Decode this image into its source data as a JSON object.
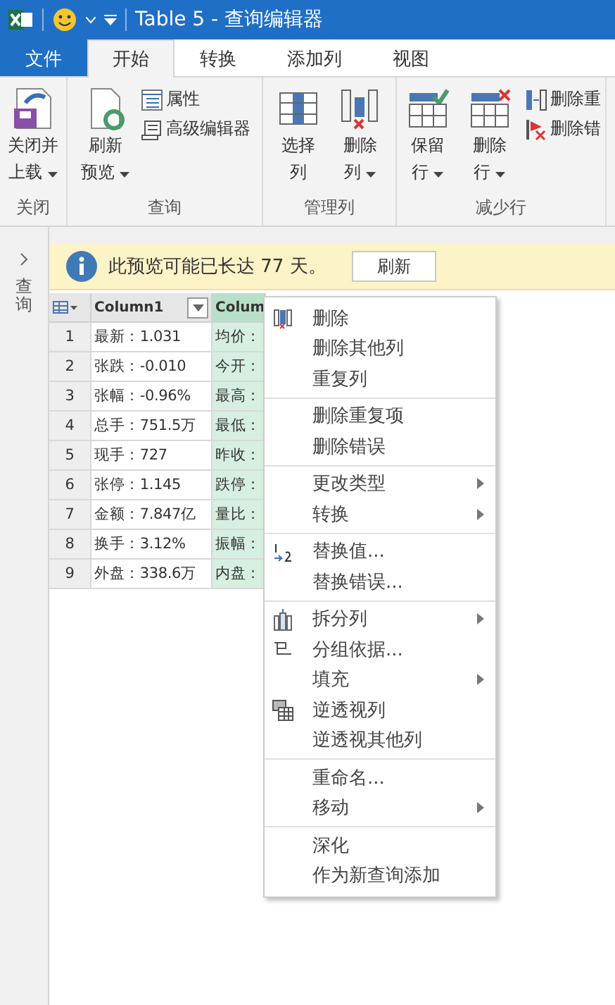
{
  "window": {
    "title": "Table 5 - 查询编辑器"
  },
  "tabs": [
    {
      "label": "文件",
      "kind": "file",
      "selected": false
    },
    {
      "label": "开始",
      "kind": "tab",
      "selected": true
    },
    {
      "label": "转换",
      "kind": "tab",
      "selected": false
    },
    {
      "label": "添加列",
      "kind": "tab",
      "selected": false
    },
    {
      "label": "视图",
      "kind": "tab",
      "selected": false
    }
  ],
  "ribbon": [
    {
      "label": "关闭",
      "items": [
        {
          "kind": "large",
          "lines": [
            "关闭并",
            "上载"
          ],
          "dropdown": true
        }
      ]
    },
    {
      "label": "查询",
      "items": [
        {
          "kind": "large",
          "lines": [
            "刷新",
            "预览"
          ],
          "dropdown": true
        },
        {
          "kind": "stack",
          "entries": [
            "属性",
            "高级编辑器"
          ]
        }
      ]
    },
    {
      "label": "管理列",
      "items": [
        {
          "kind": "large",
          "lines": [
            "选择",
            "列"
          ],
          "dropdown": false
        },
        {
          "kind": "large",
          "lines": [
            "删除",
            "列"
          ],
          "dropdown": true
        }
      ]
    },
    {
      "label": "减少行",
      "items": [
        {
          "kind": "large",
          "lines": [
            "保留",
            "行"
          ],
          "dropdown": true
        },
        {
          "kind": "large",
          "lines": [
            "删除",
            "行"
          ],
          "dropdown": true
        },
        {
          "kind": "stack",
          "entries": [
            "删除重",
            "删除错"
          ]
        }
      ]
    }
  ],
  "side_pane": {
    "label": "查询",
    "expanded": false
  },
  "notice": {
    "message": "此预览可能已长达 77 天。",
    "button": "刷新"
  },
  "table": {
    "columns": [
      {
        "name": "Column1",
        "selected": false
      },
      {
        "name": "Colum",
        "selected": true
      }
    ],
    "rows": [
      {
        "number": "1",
        "cells": [
          "最新：1.031",
          "均价："
        ]
      },
      {
        "number": "2",
        "cells": [
          "张跌：-0.010",
          "今开："
        ]
      },
      {
        "number": "3",
        "cells": [
          "张幅：-0.96%",
          "最高："
        ]
      },
      {
        "number": "4",
        "cells": [
          "总手：751.5万",
          "最低："
        ]
      },
      {
        "number": "5",
        "cells": [
          "现手：727",
          "昨收："
        ]
      },
      {
        "number": "6",
        "cells": [
          "张停：1.145",
          "跌停："
        ]
      },
      {
        "number": "7",
        "cells": [
          "金额：7.847亿",
          "量比："
        ]
      },
      {
        "number": "8",
        "cells": [
          "换手：3.12%",
          "振幅："
        ]
      },
      {
        "number": "9",
        "cells": [
          "外盘：338.6万",
          "内盘："
        ]
      }
    ]
  },
  "context_menu": [
    [
      {
        "label": "删除",
        "submenu": false
      },
      {
        "label": "删除其他列",
        "submenu": false
      },
      {
        "label": "重复列",
        "submenu": false
      }
    ],
    [
      {
        "label": "删除重复项",
        "submenu": false
      },
      {
        "label": "删除错误",
        "submenu": false
      }
    ],
    [
      {
        "label": "更改类型",
        "submenu": true
      },
      {
        "label": "转换",
        "submenu": true
      }
    ],
    [
      {
        "label": "替换值...",
        "submenu": false
      },
      {
        "label": "替换错误...",
        "submenu": false
      }
    ],
    [
      {
        "label": "拆分列",
        "submenu": true
      },
      {
        "label": "分组依据...",
        "submenu": false
      },
      {
        "label": "填充",
        "submenu": true
      },
      {
        "label": "逆透视列",
        "submenu": false
      },
      {
        "label": "逆透视其他列",
        "submenu": false
      }
    ],
    [
      {
        "label": "重命名...",
        "submenu": false
      },
      {
        "label": "移动",
        "submenu": true
      }
    ],
    [
      {
        "label": "深化",
        "submenu": false
      },
      {
        "label": "作为新查询添加",
        "submenu": false
      }
    ]
  ]
}
